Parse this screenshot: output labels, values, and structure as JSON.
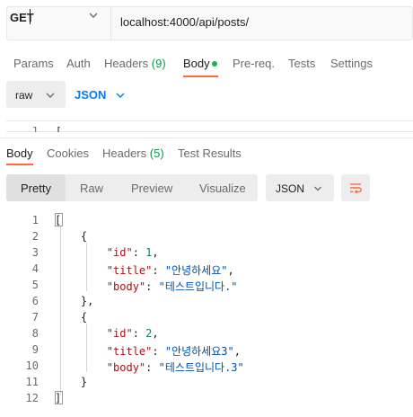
{
  "request": {
    "method": "GET",
    "url": "localhost:4000/api/posts/"
  },
  "request_tabs": [
    {
      "label": "Params"
    },
    {
      "label": "Auth"
    },
    {
      "label": "Headers",
      "count": "(9)"
    },
    {
      "label": "Body"
    },
    {
      "label": "Pre-req."
    },
    {
      "label": "Tests"
    },
    {
      "label": "Settings"
    }
  ],
  "body_options": {
    "mode": "raw",
    "language": "JSON"
  },
  "request_editor": {
    "line_number": "1",
    "text": "["
  },
  "response_tabs": [
    {
      "label": "Body"
    },
    {
      "label": "Cookies"
    },
    {
      "label": "Headers",
      "count": "(5)"
    },
    {
      "label": "Test Results"
    }
  ],
  "view_modes": [
    "Pretty",
    "Raw",
    "Preview",
    "Visualize"
  ],
  "format": "JSON",
  "response_lines": [
    {
      "n": "1",
      "parts": [
        [
          "p",
          "["
        ]
      ]
    },
    {
      "n": "2",
      "parts": [
        [
          "p",
          "    {"
        ]
      ]
    },
    {
      "n": "3",
      "parts": [
        [
          "p",
          "        "
        ],
        [
          "k",
          "\"id\""
        ],
        [
          "p",
          ": "
        ],
        [
          "n",
          "1"
        ],
        [
          "p",
          ","
        ]
      ]
    },
    {
      "n": "4",
      "parts": [
        [
          "p",
          "        "
        ],
        [
          "k",
          "\"title\""
        ],
        [
          "p",
          ": "
        ],
        [
          "s",
          "\"안녕하세요\""
        ],
        [
          "p",
          ","
        ]
      ]
    },
    {
      "n": "5",
      "parts": [
        [
          "p",
          "        "
        ],
        [
          "k",
          "\"body\""
        ],
        [
          "p",
          ": "
        ],
        [
          "s",
          "\"테스트입니다.\""
        ]
      ]
    },
    {
      "n": "6",
      "parts": [
        [
          "p",
          "    },"
        ]
      ]
    },
    {
      "n": "7",
      "parts": [
        [
          "p",
          "    {"
        ]
      ]
    },
    {
      "n": "8",
      "parts": [
        [
          "p",
          "        "
        ],
        [
          "k",
          "\"id\""
        ],
        [
          "p",
          ": "
        ],
        [
          "n",
          "2"
        ],
        [
          "p",
          ","
        ]
      ]
    },
    {
      "n": "9",
      "parts": [
        [
          "p",
          "        "
        ],
        [
          "k",
          "\"title\""
        ],
        [
          "p",
          ": "
        ],
        [
          "s",
          "\"안녕하세요3\""
        ],
        [
          "p",
          ","
        ]
      ]
    },
    {
      "n": "10",
      "parts": [
        [
          "p",
          "        "
        ],
        [
          "k",
          "\"body\""
        ],
        [
          "p",
          ": "
        ],
        [
          "s",
          "\"테스트입니다.3\""
        ]
      ]
    },
    {
      "n": "11",
      "parts": [
        [
          "p",
          "    }"
        ]
      ]
    },
    {
      "n": "12",
      "parts": [
        [
          "p",
          "]"
        ]
      ]
    }
  ],
  "colors": {
    "accent": "#ff6c37",
    "link": "#097bed",
    "json_key": "#a31515",
    "json_string": "#0451a5",
    "json_number": "#098658"
  }
}
